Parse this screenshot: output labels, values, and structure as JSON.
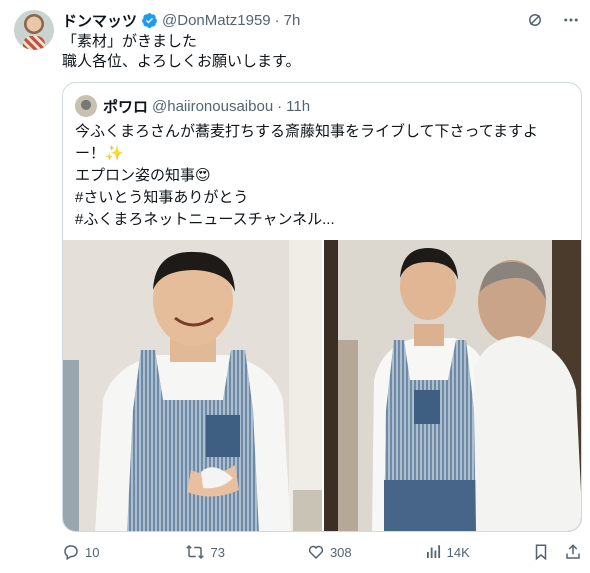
{
  "tweet": {
    "display_name": "ドンマッツ",
    "handle": "@DonMatz1959",
    "separator": "·",
    "time": "7h",
    "text_line1": "「素材」がきました",
    "text_line2": "職人各位、よろしくお願いします。"
  },
  "quote": {
    "display_name": "ポワロ",
    "handle": "@haiironousaibou",
    "separator": "·",
    "time": "11h",
    "line1": "今ふくまろさんが蕎麦打ちする斎藤知事をライブして下さってますよ",
    "line2": "ー！✨",
    "line3": "エプロン姿の知事😍",
    "line4": " #さいとう知事ありがとう",
    "line5": " #ふくまろネットニュースチャンネル..."
  },
  "actions": {
    "replies": "10",
    "reposts": "73",
    "likes": "308",
    "views": "14K"
  },
  "colors": {
    "accent": "#1d9bf0",
    "muted": "#536471",
    "repost": "#00ba7c",
    "border": "#cfd9de"
  },
  "icons": [
    "verified-badge-icon",
    "grok-icon",
    "more-icon",
    "reply-icon",
    "repost-icon",
    "like-icon",
    "views-icon",
    "bookmark-icon",
    "share-icon"
  ]
}
